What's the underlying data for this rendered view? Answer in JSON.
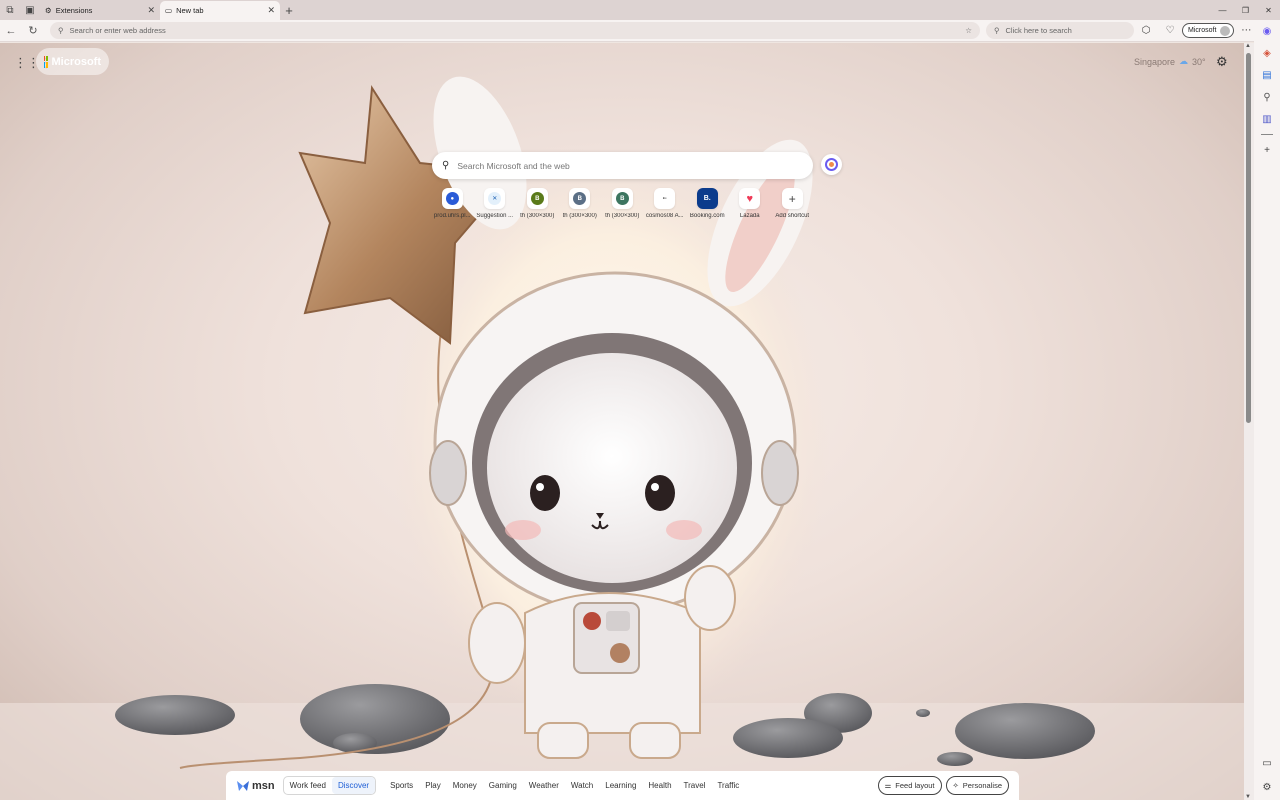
{
  "tabs": [
    {
      "label": "Extensions",
      "active": false
    },
    {
      "label": "New tab",
      "active": true
    }
  ],
  "toolbar": {
    "address_placeholder": "Search or enter web address",
    "search_placeholder": "Click here to search",
    "profile_label": "Microsoft"
  },
  "newtab": {
    "brand": "Microsoft",
    "weather_location": "Singapore",
    "weather_temp": "30°",
    "search_placeholder": "Search Microsoft and the web",
    "shortcuts": [
      {
        "label": "prod.uhrs.pl...",
        "letter": "",
        "color": "#2a5bd7"
      },
      {
        "label": "Suggestion ...",
        "letter": "",
        "color": "#1b5fb3"
      },
      {
        "label": "th (300×300)",
        "letter": "B",
        "color": "#5a7a1a"
      },
      {
        "label": "th (300×300)",
        "letter": "B",
        "color": "#5b6f86"
      },
      {
        "label": "th (300×300)",
        "letter": "B",
        "color": "#3d7560"
      },
      {
        "label": "cosmos08 A...",
        "letter": "",
        "color": "#6b6b6b"
      },
      {
        "label": "Booking.com",
        "letter": "B.",
        "color": "#0b3b8c"
      },
      {
        "label": "Lazada",
        "letter": "",
        "color": "#ef3b58"
      },
      {
        "label": "Add shortcut",
        "letter": "+",
        "color": "#444444"
      }
    ]
  },
  "feed": {
    "brand": "msn",
    "tabs": [
      {
        "label": "Work feed",
        "selected": false
      },
      {
        "label": "Discover",
        "selected": true
      }
    ],
    "categories": [
      "Sports",
      "Play",
      "Money",
      "Gaming",
      "Weather",
      "Watch",
      "Learning",
      "Health",
      "Travel",
      "Traffic"
    ],
    "feed_layout_label": "Feed layout",
    "personalise_label": "Personalise"
  }
}
